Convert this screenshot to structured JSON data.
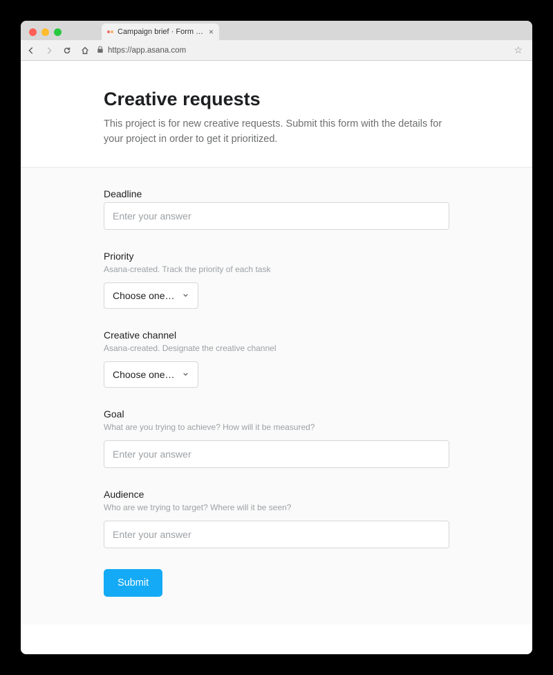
{
  "browser": {
    "tab_title": "Campaign brief · Form by As",
    "url": "https://app.asana.com"
  },
  "header": {
    "title": "Creative requests",
    "description": "This project is for new creative requests. Submit this form with the details for your project in order to get it prioritized."
  },
  "fields": {
    "deadline": {
      "label": "Deadline",
      "placeholder": "Enter your answer"
    },
    "priority": {
      "label": "Priority",
      "description": "Asana-created. Track the priority of each task",
      "selected": "Choose one…"
    },
    "channel": {
      "label": "Creative channel",
      "description": "Asana-created. Designate the creative channel",
      "selected": "Choose one…"
    },
    "goal": {
      "label": "Goal",
      "description": "What are you trying to achieve? How will it be measured?",
      "placeholder": "Enter your answer"
    },
    "audience": {
      "label": "Audience",
      "description": "Who are we trying to target? Where will it be seen?",
      "placeholder": "Enter your answer"
    }
  },
  "submit_label": "Submit"
}
